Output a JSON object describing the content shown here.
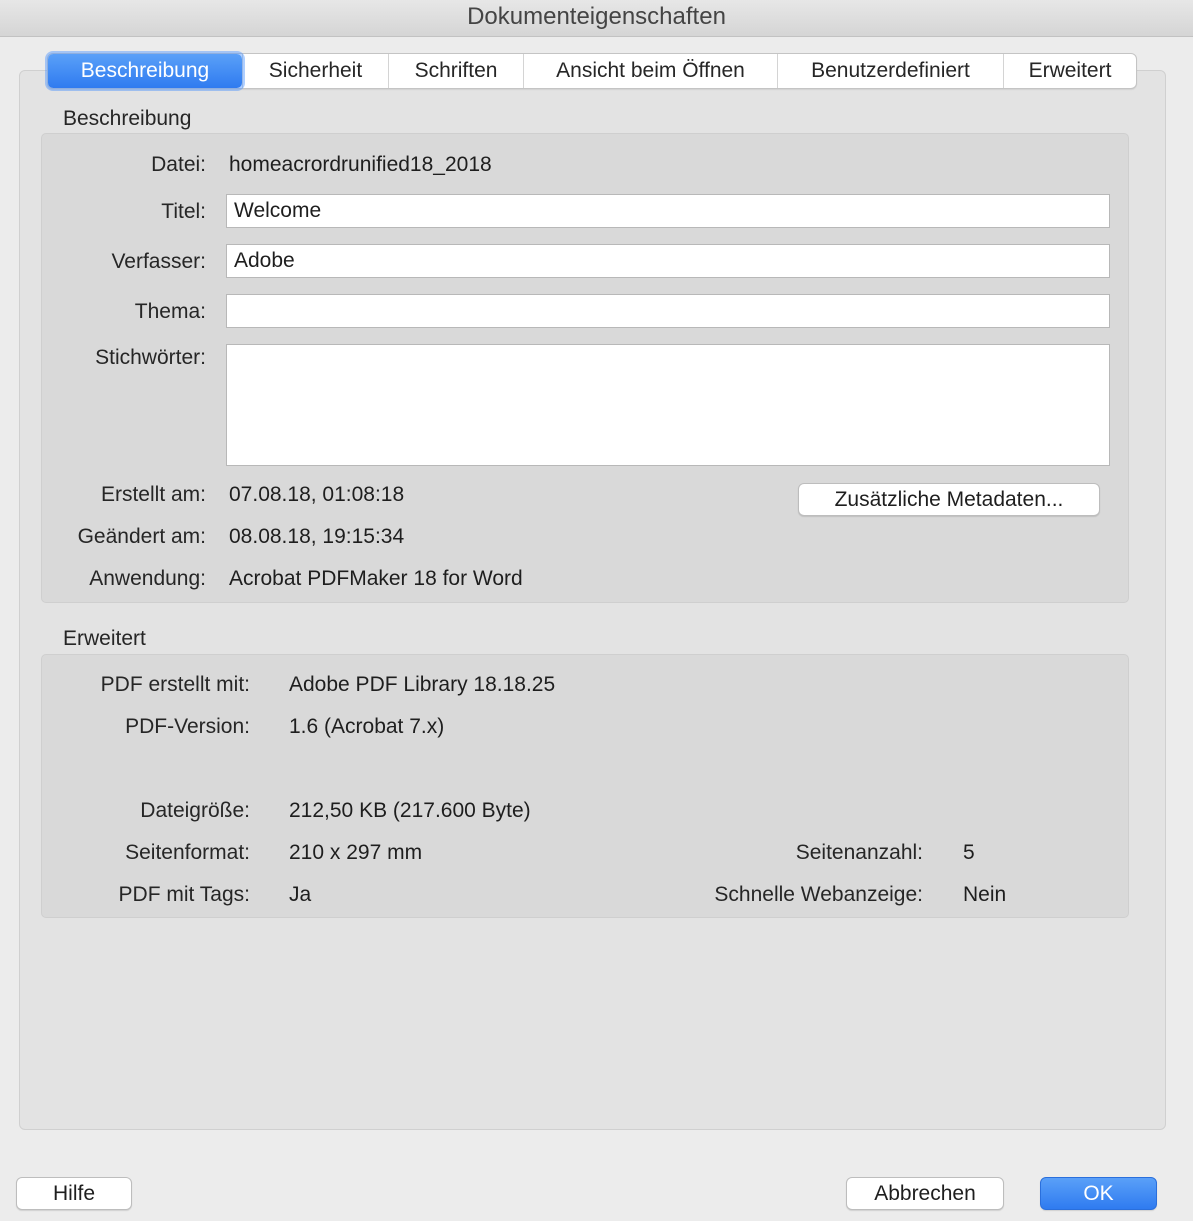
{
  "window": {
    "title": "Dokumenteigenschaften"
  },
  "tabs": [
    {
      "label": "Beschreibung",
      "active": true
    },
    {
      "label": "Sicherheit",
      "active": false
    },
    {
      "label": "Schriften",
      "active": false
    },
    {
      "label": "Ansicht beim Öffnen",
      "active": false
    },
    {
      "label": "Benutzerdefiniert",
      "active": false
    },
    {
      "label": "Erweitert",
      "active": false
    }
  ],
  "description": {
    "header": "Beschreibung",
    "file_label": "Datei:",
    "file_value": "homeacrordrunified18_2018",
    "title_label": "Titel:",
    "title_value": "Welcome",
    "author_label": "Verfasser:",
    "author_value": "Adobe",
    "subject_label": "Thema:",
    "subject_value": "",
    "keywords_label": "Stichwörter:",
    "keywords_value": "",
    "created_label": "Erstellt am:",
    "created_value": "07.08.18, 01:08:18",
    "modified_label": "Geändert am:",
    "modified_value": "08.08.18, 19:15:34",
    "application_label": "Anwendung:",
    "application_value": "Acrobat PDFMaker 18 for Word",
    "metadata_button": "Zusätzliche Metadaten..."
  },
  "advanced": {
    "header": "Erweitert",
    "producer_label": "PDF erstellt mit:",
    "producer_value": "Adobe PDF Library 18.18.25",
    "version_label": "PDF-Version:",
    "version_value": "1.6 (Acrobat 7.x)",
    "filesize_label": "Dateigröße:",
    "filesize_value": "212,50 KB (217.600 Byte)",
    "pagesize_label": "Seitenformat:",
    "pagesize_value": "210 x 297 mm",
    "pagecount_label": "Seitenanzahl:",
    "pagecount_value": "5",
    "tagged_label": "PDF mit Tags:",
    "tagged_value": "Ja",
    "fastweb_label": "Schnelle Webanzeige:",
    "fastweb_value": "Nein"
  },
  "footer": {
    "help_button": "Hilfe",
    "cancel_button": "Abbrechen",
    "ok_button": "OK"
  },
  "colors": {
    "accent": "#2f7bf0",
    "window_bg": "#ececec",
    "group_bg": "#d9d9d9"
  }
}
